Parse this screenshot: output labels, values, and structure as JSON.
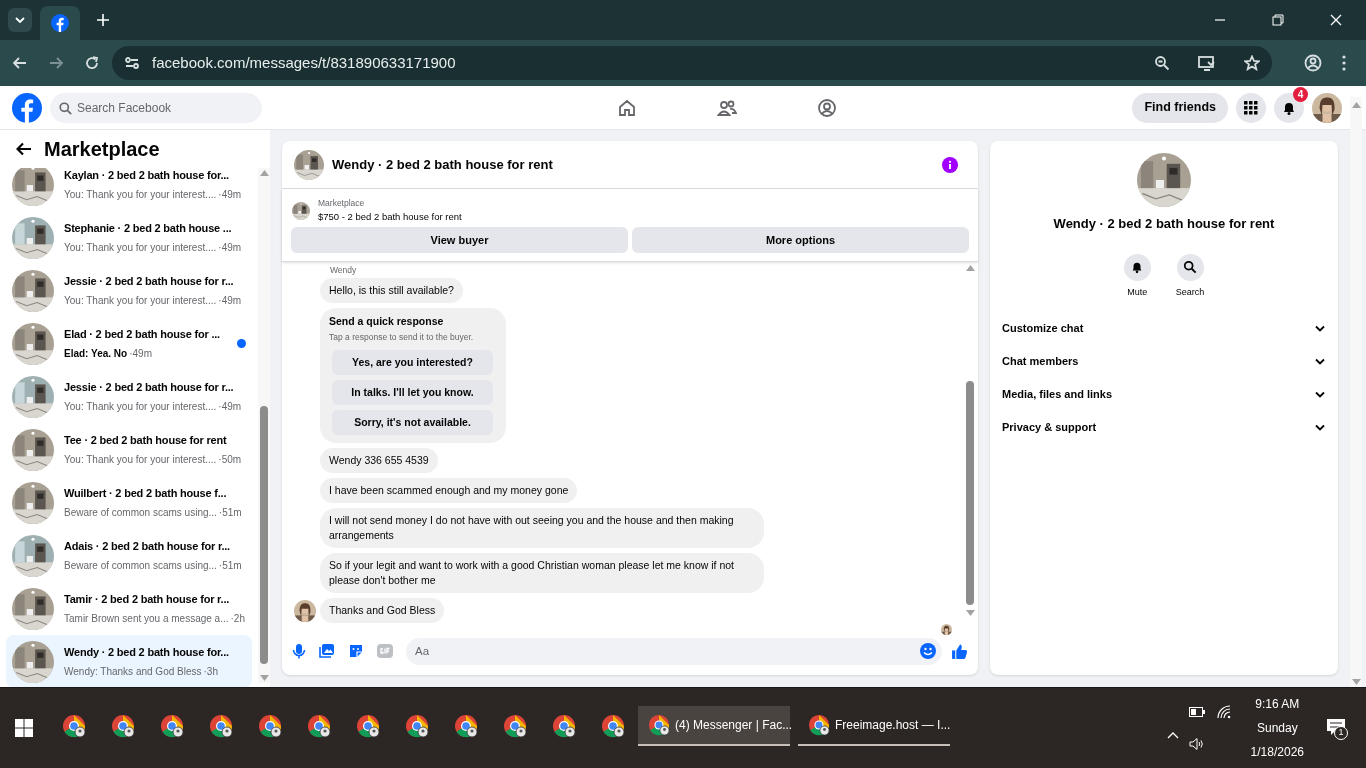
{
  "browser": {
    "url": "facebook.com/messages/t/831890633171900"
  },
  "header": {
    "search_placeholder": "Search Facebook",
    "find_friends": "Find friends",
    "notification_count": "4"
  },
  "sidebar": {
    "title": "Marketplace",
    "items": [
      {
        "title": "Kaylan · 2 bed 2 bath house for...",
        "preview": "You: Thank you for your interest....",
        "time": "·49m",
        "unread": false,
        "selected": false
      },
      {
        "title": "Stephanie · 2 bed 2 bath house ...",
        "preview": "You: Thank you for your interest....",
        "time": "·49m",
        "unread": false,
        "selected": false
      },
      {
        "title": "Jessie · 2 bed 2 bath house for r...",
        "preview": "You: Thank you for your interest....",
        "time": "·49m",
        "unread": false,
        "selected": false
      },
      {
        "title": "Elad · 2 bed 2 bath house for ...",
        "preview": "Elad: Yea. No",
        "time": "·49m",
        "unread": true,
        "selected": false
      },
      {
        "title": "Jessie · 2 bed 2 bath house for r...",
        "preview": "You: Thank you for your interest....",
        "time": "·49m",
        "unread": false,
        "selected": false
      },
      {
        "title": "Tee · 2 bed 2 bath house for rent",
        "preview": "You: Thank you for your interest....",
        "time": "·50m",
        "unread": false,
        "selected": false
      },
      {
        "title": "Wuilbert · 2 bed 2 bath house f...",
        "preview": "Beware of common scams using...",
        "time": "·51m",
        "unread": false,
        "selected": false
      },
      {
        "title": "Adais · 2 bed 2 bath house for r...",
        "preview": "Beware of common scams using...",
        "time": "·51m",
        "unread": false,
        "selected": false
      },
      {
        "title": "Tamir · 2 bed 2 bath house for r...",
        "preview": "Tamir Brown sent you a message a...",
        "time": "·2h",
        "unread": false,
        "selected": false
      },
      {
        "title": "Wendy · 2 bed 2 bath house for...",
        "preview": "Wendy: Thanks and God Bless",
        "time": "·3h",
        "unread": false,
        "selected": true
      }
    ]
  },
  "chat": {
    "title": "Wendy · 2 bed 2 bath house for rent",
    "listing_label": "Marketplace",
    "listing": "$750 - 2 bed 2 bath house for rent",
    "buttons": [
      "View buyer",
      "More options"
    ],
    "sender": "Wendy",
    "messages": [
      {
        "kind": "text",
        "text": "Hello, is this still available?"
      },
      {
        "kind": "quick_response",
        "title": "Send a quick response",
        "hint": "Tap a response to send it to the buyer.",
        "options": [
          "Yes, are you interested?",
          "In talks. I'll let you know.",
          "Sorry, it's not available."
        ]
      },
      {
        "kind": "text",
        "text": "Wendy 336 655 4539"
      },
      {
        "kind": "text",
        "text": "I have been scammed enough and my money gone"
      },
      {
        "kind": "text",
        "text": "I will not send money I do not have with out seeing you and the house and then making arrangements"
      },
      {
        "kind": "text",
        "text": "So if your legit and want to work with a good Christian woman please let me know if not please don't bother me"
      },
      {
        "kind": "text",
        "text": "Thanks and God Bless",
        "avatar": true
      }
    ],
    "composer_placeholder": "Aa"
  },
  "info_panel": {
    "title": "Wendy · 2 bed 2 bath house for rent",
    "actions": [
      "Mute",
      "Search"
    ],
    "sections": [
      "Customize chat",
      "Chat members",
      "Media, files and links",
      "Privacy & support"
    ]
  },
  "taskbar": {
    "windows": [
      {
        "label": "(4) Messenger | Fac...",
        "selected": true
      },
      {
        "label": "Freeimage.host — I...",
        "selected": false
      }
    ],
    "time": "9:16 AM",
    "day": "Sunday",
    "date": "1/18/2026",
    "notification_count": "1"
  }
}
